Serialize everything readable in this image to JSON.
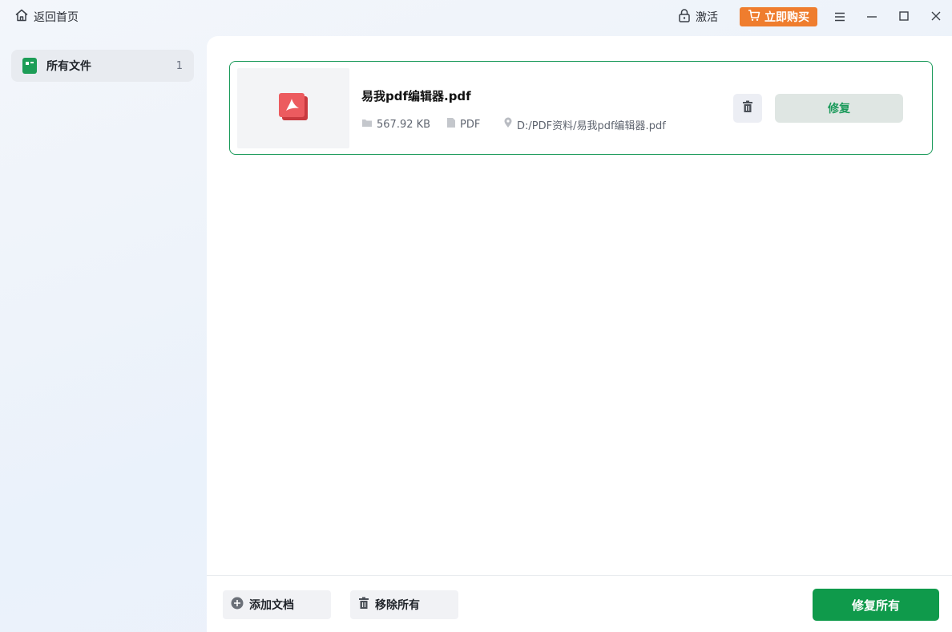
{
  "titlebar": {
    "home_label": "返回首页",
    "activate_label": "激活",
    "buy_label": "立即购买",
    "buy_color": "#ef7d2e"
  },
  "sidebar": {
    "items": [
      {
        "label": "所有文件",
        "count": "1",
        "icon": "files-icon"
      }
    ]
  },
  "files": [
    {
      "name": "易我pdf编辑器.pdf",
      "size": "567.92 KB",
      "type": "PDF",
      "path": "D:/PDF资料/易我pdf编辑器.pdf",
      "repair_label": "修复"
    }
  ],
  "bottom": {
    "add_label": "添加文档",
    "remove_label": "移除所有",
    "repair_all_label": "修复所有"
  },
  "colors": {
    "accent": "#0f9a4b",
    "card_border": "#1a9a5a",
    "pdf_icon": "#e5484d"
  }
}
